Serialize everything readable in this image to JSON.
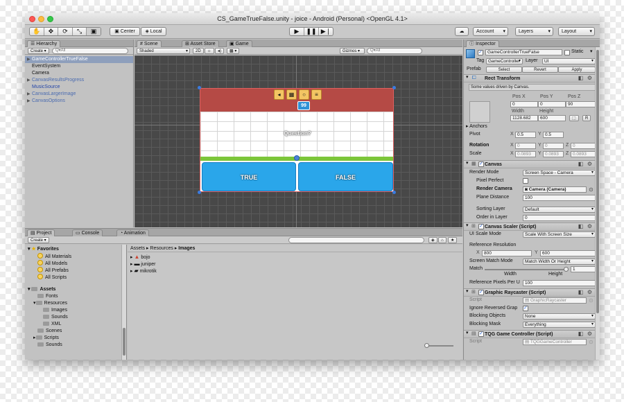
{
  "window": {
    "title": "CS_GameTrueFalse.unity - joice - Android (Personal) <OpenGL 4.1>"
  },
  "toolbar": {
    "pivot_label": "Center",
    "space_label": "Local",
    "account": "Account",
    "layers": "Layers",
    "layout": "Layout",
    "tools": [
      "✋",
      "✥",
      "⟳",
      "⤡",
      "▣"
    ],
    "play": [
      "▶",
      "❚❚",
      "▶❘"
    ]
  },
  "hierarchy": {
    "tab": "Hierarchy",
    "create": "Create",
    "search_placeholder": "Q▾All",
    "items": [
      "GameControllerTrueFalse",
      "EventSystem",
      "Camera",
      "CanvasResultsProgress",
      "MusicSource",
      "CanvasLargerImage",
      "CanvasOptions"
    ]
  },
  "scene": {
    "tabs": [
      "Scene",
      "Asset Store",
      "Game"
    ],
    "shading": "Shaded",
    "mode": "2D",
    "gizmos": "Gizmos",
    "search_placeholder": "Q▾All",
    "score": "99",
    "question": "Question?",
    "true_label": "TRUE",
    "false_label": "FALSE"
  },
  "project": {
    "tabs": [
      "Project",
      "Console",
      "Animation"
    ],
    "create": "Create",
    "breadcrumb": [
      "Assets",
      "Resources",
      "Images"
    ],
    "favorites_title": "Favorites",
    "favorites": [
      "All Materials",
      "All Models",
      "All Prefabs",
      "All Scripts"
    ],
    "assets_title": "Assets",
    "tree": [
      "Fonts",
      "Resources",
      "Images",
      "Sounds",
      "XML",
      "Scenes",
      "Scripts",
      "Sounds"
    ],
    "files": [
      "bojo",
      "juniper",
      "mikrotik"
    ]
  },
  "inspector": {
    "tab": "Inspector",
    "object_name": "GameControllerTrueFalse",
    "static": "Static",
    "tag_label": "Tag",
    "tag_value": "GameController",
    "layer_label": "Layer",
    "layer_value": "UI",
    "prefab_label": "Prefab",
    "prefab_buttons": [
      "Select",
      "Revert",
      "Apply"
    ],
    "rect": {
      "title": "Rect Transform",
      "note": "Some values driven by Canvas.",
      "pos_x_label": "Pos X",
      "pos_y_label": "Pos Y",
      "pos_z_label": "Pos Z",
      "pos_x": "0",
      "pos_y": "0",
      "pos_z": "90",
      "width_label": "Width",
      "height_label": "Height",
      "width": "1128.682",
      "height": "600",
      "anchors": "Anchors",
      "pivot_label": "Pivot",
      "pivot_x": "0.5",
      "pivot_y": "0.5",
      "rotation_label": "Rotation",
      "rot_x": "0",
      "rot_y": "0",
      "rot_z": "0",
      "scale_label": "Scale",
      "scale_x": "0.0893",
      "scale_y": "0.0893",
      "scale_z": "0.0893",
      "x": "X",
      "y": "Y",
      "z": "Z",
      "r_button": "R"
    },
    "canvas": {
      "title": "Canvas",
      "render_mode_label": "Render Mode",
      "render_mode": "Screen Space - Camera",
      "pixel_perfect": "Pixel Perfect",
      "render_camera_label": "Render Camera",
      "render_camera": "Camera (Camera)",
      "plane_distance_label": "Plane Distance",
      "plane_distance": "100",
      "sorting_layer_label": "Sorting Layer",
      "sorting_layer": "Default",
      "order_label": "Order in Layer",
      "order": "0"
    },
    "scaler": {
      "title": "Canvas Scaler (Script)",
      "ui_scale_label": "UI Scale Mode",
      "ui_scale": "Scale With Screen Size",
      "ref_res_label": "Reference Resolution",
      "ref_x": "800",
      "ref_y": "600",
      "match_mode_label": "Screen Match Mode",
      "match_mode": "Match Width Or Height",
      "match_label": "Match",
      "match_value": "1",
      "match_fraction": 1,
      "width_word": "Width",
      "height_word": "Height",
      "ref_ppu_label": "Reference Pixels Per U",
      "ref_ppu": "100"
    },
    "raycaster": {
      "title": "Graphic Raycaster (Script)",
      "script_label": "Script",
      "script": "GraphicRaycaster",
      "ignore_label": "Ignore Reversed Grap",
      "blocking_objects_label": "Blocking Objects",
      "blocking_objects": "None",
      "blocking_mask_label": "Blocking Mask",
      "blocking_mask": "Everything"
    },
    "tqg": {
      "title": "TQG Game Controller (Script)",
      "script_label": "Script",
      "script": "TQGGameController"
    }
  },
  "colors": {
    "red": "#b54a45",
    "blue": "#2aa6ea",
    "green": "#7cc63a",
    "score": "#2f92d6"
  }
}
